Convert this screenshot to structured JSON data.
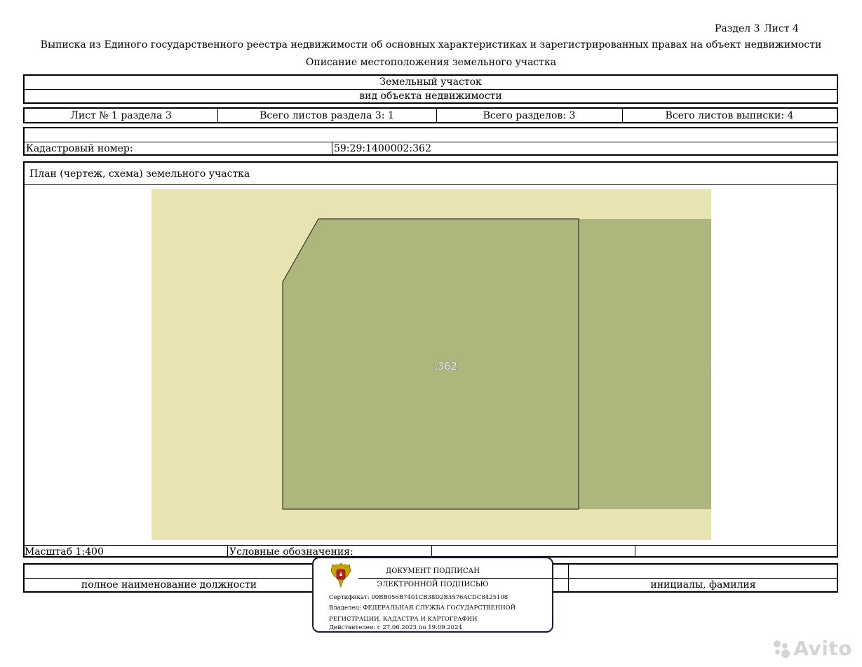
{
  "header": {
    "section": "Раздел 3",
    "sheet": "Лист 4",
    "title": "Выписка из Единого государственного реестра недвижимости об основных характеристиках и зарегистрированных правах на объект недвижимости",
    "subtitle": "Описание местоположения земельного участка"
  },
  "object": {
    "type": "Земельный участок",
    "type_caption": "вид объекта недвижимости"
  },
  "sheet_info": {
    "sheet_number": "Лист № 1 раздела 3",
    "total_sheets_section": "Всего листов раздела 3: 1",
    "total_sections": "Всего разделов: 3",
    "total_sheets_extract": "Всего листов выписки: 4"
  },
  "cadastral": {
    "label": "Кадастровый номер:",
    "value": "59:29:1400002:362"
  },
  "plan": {
    "title": "План (чертеж, схема) земельного участка",
    "parcel_label": ":362",
    "neighbor_label": ":",
    "colors": {
      "background": "#e8e3b0",
      "parcel": "#adb77d",
      "outline": "#1a1a1a"
    }
  },
  "legend_row": {
    "scale": "Масштаб 1:400",
    "legend_label": "Условные обозначения:"
  },
  "signature_row": {
    "position": "полное наименование должности",
    "initials": "инициалы, фамилия"
  },
  "stamp": {
    "line1": "ДОКУМЕНТ ПОДПИСАН",
    "line2": "ЭЛЕКТРОННОЙ ПОДПИСЬЮ",
    "certificate": "Сертификат: 00BB056B7401CB38D2B3576ACDC8425108",
    "owner_line1": "Владелец: ФЕДЕРАЛЬНАЯ СЛУЖБА ГОСУДАРСТВЕННОЙ",
    "owner_line2": "РЕГИСТРАЦИИ, КАДАСТРА И КАРТОГРАФИИ",
    "valid": "Действителен: с 27.06.2023 по 19.09.2024",
    "emblem": "coat-of-arms-icon",
    "border_color": "#1c1c40"
  },
  "watermark": {
    "text": "Avito",
    "icon": "avito-logo-icon"
  }
}
